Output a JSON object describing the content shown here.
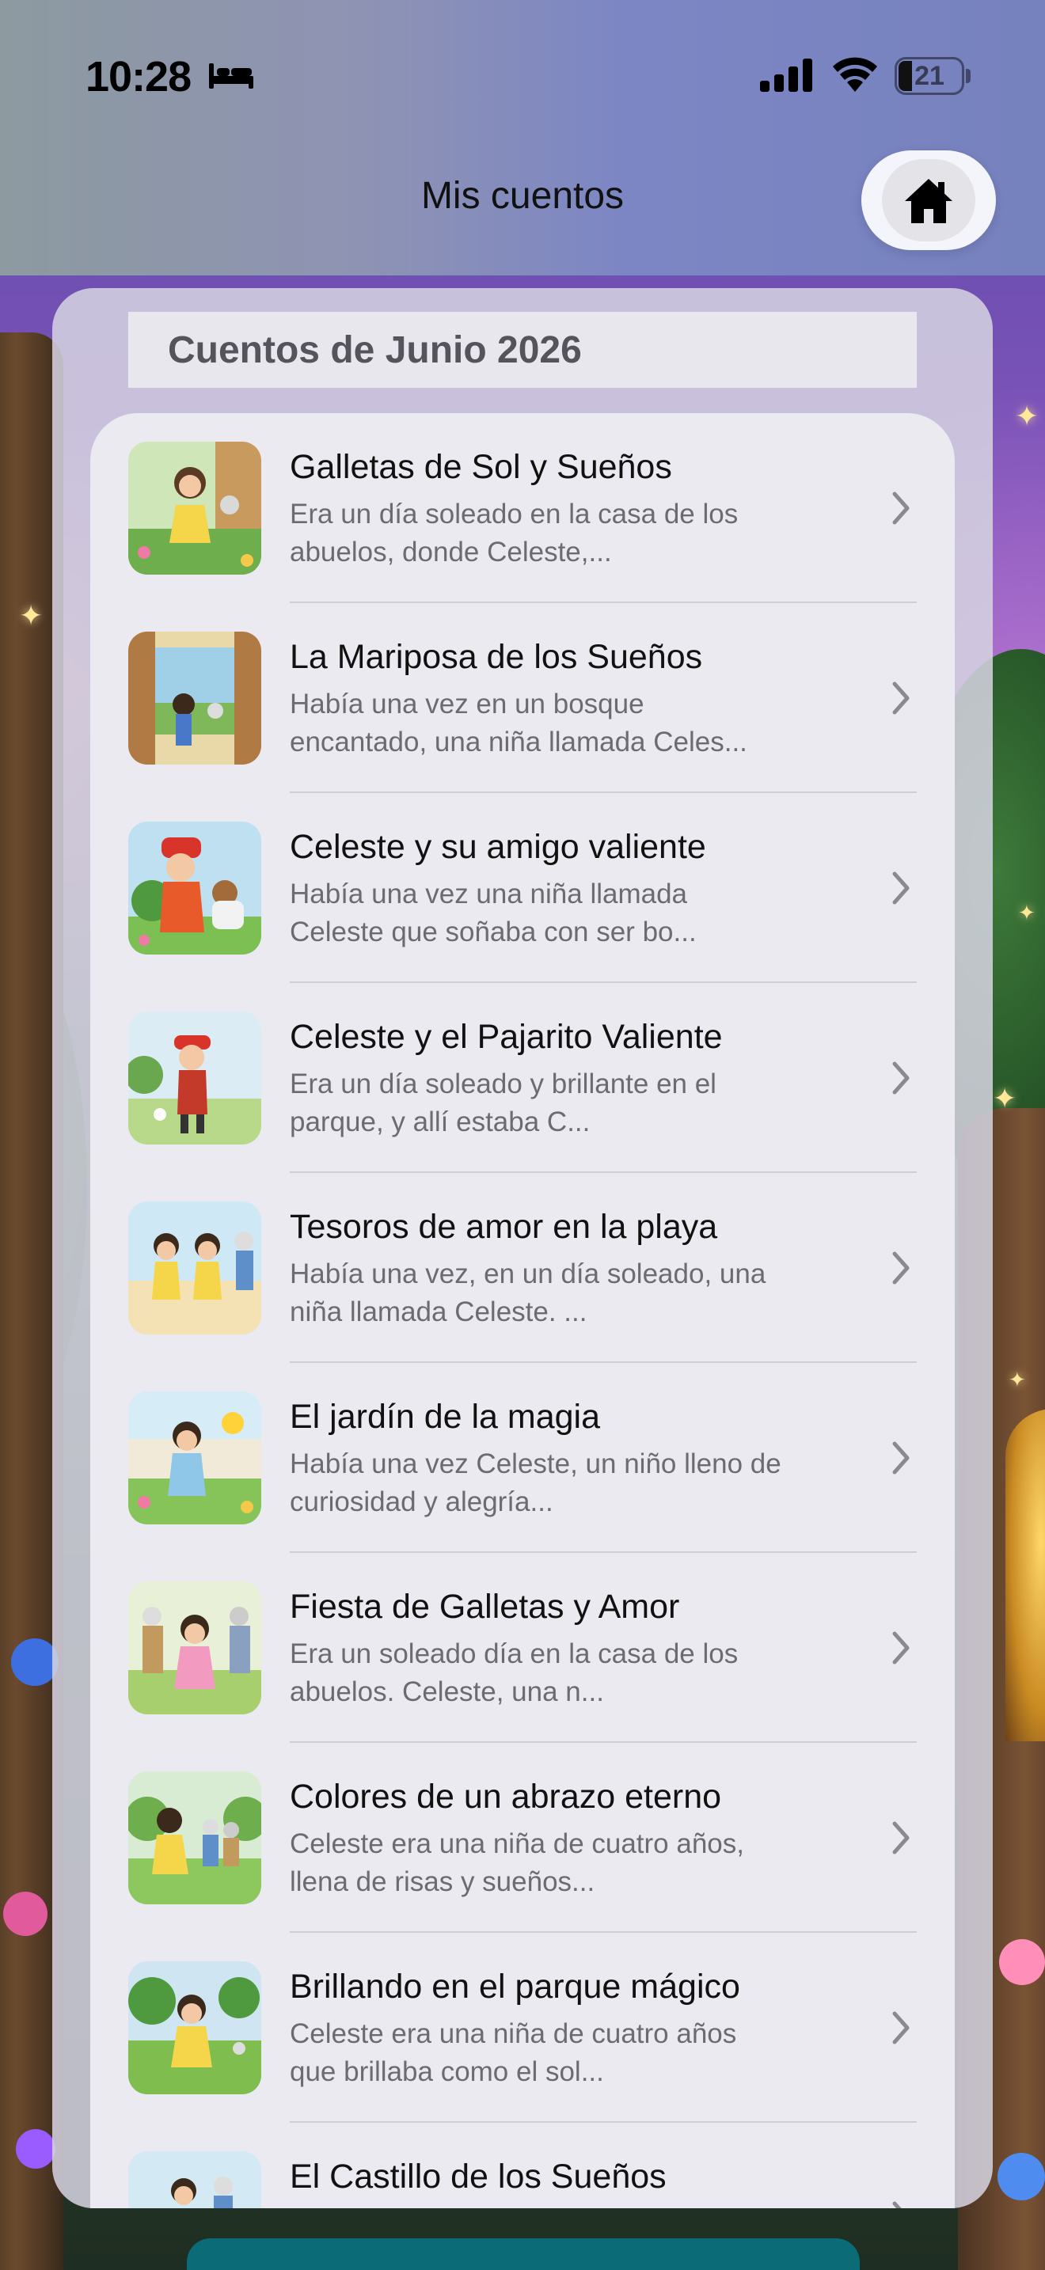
{
  "status_bar": {
    "time": "10:28",
    "battery_level": "21",
    "icons": [
      "bed-icon",
      "cellular-signal-icon",
      "wifi-icon",
      "battery-icon"
    ]
  },
  "header": {
    "title": "Mis cuentos",
    "home_icon": "home-icon"
  },
  "section": {
    "title": "Cuentos de Junio 2026"
  },
  "stories": [
    {
      "title": "Galletas de Sol y Sueños",
      "desc_line1": "Era un día soleado en la casa de los",
      "desc_line2": "abuelos, donde Celeste,..."
    },
    {
      "title": "La Mariposa de los Sueños",
      "desc_line1": "Había una vez en un bosque",
      "desc_line2": "encantado, una niña llamada Celes..."
    },
    {
      "title": "Celeste y su amigo valiente",
      "desc_line1": "Había una vez una niña llamada",
      "desc_line2": "Celeste que soñaba con ser bo..."
    },
    {
      "title": "Celeste y el Pajarito Valiente",
      "desc_line1": "Era un día soleado y brillante en el",
      "desc_line2": "parque, y allí estaba C..."
    },
    {
      "title": "Tesoros de amor en la playa",
      "desc_line1": "Había una vez, en un día soleado, una",
      "desc_line2": "niña llamada Celeste. ..."
    },
    {
      "title": "El jardín de la magia",
      "desc_line1": "Había una vez Celeste, un niño lleno de",
      "desc_line2": "curiosidad y alegría..."
    },
    {
      "title": "Fiesta de Galletas y Amor",
      "desc_line1": "Era un soleado día en la casa de los",
      "desc_line2": "abuelos. Celeste, una n..."
    },
    {
      "title": "Colores de un abrazo eterno",
      "desc_line1": "Celeste era una niña de cuatro años,",
      "desc_line2": "llena de risas y sueños..."
    },
    {
      "title": "Brillando en el parque mágico",
      "desc_line1": "Celeste era una niña de cuatro años",
      "desc_line2": "que brillaba como el sol..."
    },
    {
      "title": "El Castillo de los Sueños",
      "desc_line1": "",
      "desc_line2": ""
    }
  ],
  "colors": {
    "accent_teal": "#0b6b77",
    "header_tint": "#7c86c4",
    "list_bg": "#ebeaf0",
    "subtitle_gray": "#6c6b73"
  }
}
